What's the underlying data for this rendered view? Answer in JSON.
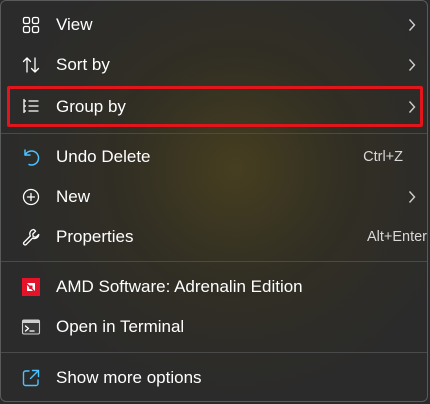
{
  "menu": {
    "items": [
      {
        "label": "View",
        "icon": "grid-icon",
        "has_submenu": true
      },
      {
        "label": "Sort by",
        "icon": "sort-arrows-icon",
        "has_submenu": true
      },
      {
        "label": "Group by",
        "icon": "group-list-icon",
        "has_submenu": true,
        "highlighted": true
      },
      {
        "label": "Undo Delete",
        "icon": "undo-icon",
        "shortcut": "Ctrl+Z"
      },
      {
        "label": "New",
        "icon": "plus-circle-icon",
        "has_submenu": true
      },
      {
        "label": "Properties",
        "icon": "wrench-icon",
        "shortcut": "Alt+Enter"
      },
      {
        "label": "AMD Software: Adrenalin Edition",
        "icon": "amd-logo-icon"
      },
      {
        "label": "Open in Terminal",
        "icon": "terminal-icon"
      },
      {
        "label": "Show more options",
        "icon": "share-external-icon"
      }
    ]
  },
  "colors": {
    "accent": "#4cc2ff",
    "highlight_border": "#e0161c",
    "amd_red": "#e5132a"
  }
}
